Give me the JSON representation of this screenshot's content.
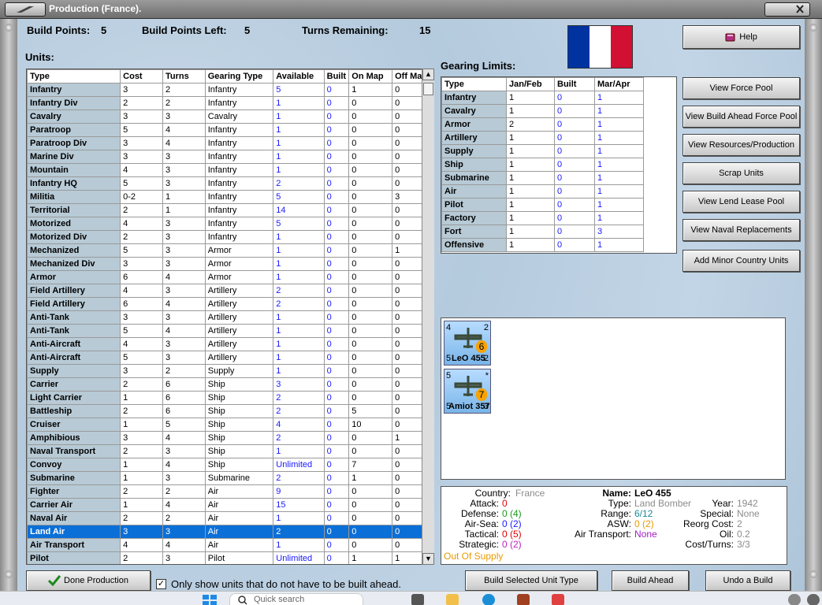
{
  "window": {
    "title": "Production (France)."
  },
  "summary": {
    "build_points_label": "Build Points:",
    "build_points": "5",
    "build_points_left_label": "Build Points Left:",
    "build_points_left": "5",
    "turns_remaining_label": "Turns Remaining:",
    "turns_remaining": "15"
  },
  "units": {
    "heading": "Units:",
    "columns": [
      "Type",
      "Cost",
      "Turns",
      "Gearing Type",
      "Available",
      "Built",
      "On Map",
      "Off Map"
    ],
    "rows": [
      [
        "Infantry",
        "3",
        "2",
        "Infantry",
        "5",
        "0",
        "1",
        "0"
      ],
      [
        "Infantry Div",
        "2",
        "2",
        "Infantry",
        "1",
        "0",
        "0",
        "0"
      ],
      [
        "Cavalry",
        "3",
        "3",
        "Cavalry",
        "1",
        "0",
        "0",
        "0"
      ],
      [
        "Paratroop",
        "5",
        "4",
        "Infantry",
        "1",
        "0",
        "0",
        "0"
      ],
      [
        "Paratroop Div",
        "3",
        "4",
        "Infantry",
        "1",
        "0",
        "0",
        "0"
      ],
      [
        "Marine Div",
        "3",
        "3",
        "Infantry",
        "1",
        "0",
        "0",
        "0"
      ],
      [
        "Mountain",
        "4",
        "3",
        "Infantry",
        "1",
        "0",
        "0",
        "0"
      ],
      [
        "Infantry HQ",
        "5",
        "3",
        "Infantry",
        "2",
        "0",
        "0",
        "0"
      ],
      [
        "Militia",
        "0-2",
        "1",
        "Infantry",
        "5",
        "0",
        "0",
        "3"
      ],
      [
        "Territorial",
        "2",
        "1",
        "Infantry",
        "14",
        "0",
        "0",
        "0"
      ],
      [
        "Motorized",
        "4",
        "3",
        "Infantry",
        "5",
        "0",
        "0",
        "0"
      ],
      [
        "Motorized Div",
        "2",
        "3",
        "Infantry",
        "1",
        "0",
        "0",
        "0"
      ],
      [
        "Mechanized",
        "5",
        "3",
        "Armor",
        "1",
        "0",
        "0",
        "1"
      ],
      [
        "Mechanized Div",
        "3",
        "3",
        "Armor",
        "1",
        "0",
        "0",
        "0"
      ],
      [
        "Armor",
        "6",
        "4",
        "Armor",
        "1",
        "0",
        "0",
        "0"
      ],
      [
        "Field Artillery",
        "4",
        "3",
        "Artillery",
        "2",
        "0",
        "0",
        "0"
      ],
      [
        "Field Artillery",
        "6",
        "4",
        "Artillery",
        "2",
        "0",
        "0",
        "0"
      ],
      [
        "Anti-Tank",
        "3",
        "3",
        "Artillery",
        "1",
        "0",
        "0",
        "0"
      ],
      [
        "Anti-Tank",
        "5",
        "4",
        "Artillery",
        "1",
        "0",
        "0",
        "0"
      ],
      [
        "Anti-Aircraft",
        "4",
        "3",
        "Artillery",
        "1",
        "0",
        "0",
        "0"
      ],
      [
        "Anti-Aircraft",
        "5",
        "3",
        "Artillery",
        "1",
        "0",
        "0",
        "0"
      ],
      [
        "Supply",
        "3",
        "2",
        "Supply",
        "1",
        "0",
        "0",
        "0"
      ],
      [
        "Carrier",
        "2",
        "6",
        "Ship",
        "3",
        "0",
        "0",
        "0"
      ],
      [
        "Light Carrier",
        "1",
        "6",
        "Ship",
        "2",
        "0",
        "0",
        "0"
      ],
      [
        "Battleship",
        "2",
        "6",
        "Ship",
        "2",
        "0",
        "5",
        "0"
      ],
      [
        "Cruiser",
        "1",
        "5",
        "Ship",
        "4",
        "0",
        "10",
        "0"
      ],
      [
        "Amphibious",
        "3",
        "4",
        "Ship",
        "2",
        "0",
        "0",
        "1"
      ],
      [
        "Naval Transport",
        "2",
        "3",
        "Ship",
        "1",
        "0",
        "0",
        "0"
      ],
      [
        "Convoy",
        "1",
        "4",
        "Ship",
        "Unlimited",
        "0",
        "7",
        "0"
      ],
      [
        "Submarine",
        "1",
        "3",
        "Submarine",
        "2",
        "0",
        "1",
        "0"
      ],
      [
        "Fighter",
        "2",
        "2",
        "Air",
        "9",
        "0",
        "0",
        "0"
      ],
      [
        "Carrier Air",
        "1",
        "4",
        "Air",
        "15",
        "0",
        "0",
        "0"
      ],
      [
        "Naval Air",
        "2",
        "2",
        "Air",
        "1",
        "0",
        "0",
        "0"
      ],
      [
        "Land Air",
        "3",
        "3",
        "Air",
        "2",
        "0",
        "0",
        "0"
      ],
      [
        "Air Transport",
        "4",
        "4",
        "Air",
        "1",
        "0",
        "0",
        "0"
      ],
      [
        "Pilot",
        "2",
        "3",
        "Pilot",
        "Unlimited",
        "0",
        "1",
        "1"
      ]
    ],
    "selected_row": 33
  },
  "gearing": {
    "heading": "Gearing Limits:",
    "columns": [
      "Type",
      "Jan/Feb",
      "Built",
      "Mar/Apr"
    ],
    "rows": [
      [
        "Infantry",
        "1",
        "0",
        "1"
      ],
      [
        "Cavalry",
        "1",
        "0",
        "1"
      ],
      [
        "Armor",
        "2",
        "0",
        "1"
      ],
      [
        "Artillery",
        "1",
        "0",
        "1"
      ],
      [
        "Supply",
        "1",
        "0",
        "1"
      ],
      [
        "Ship",
        "1",
        "0",
        "1"
      ],
      [
        "Submarine",
        "1",
        "0",
        "1"
      ],
      [
        "Air",
        "1",
        "0",
        "1"
      ],
      [
        "Pilot",
        "1",
        "0",
        "1"
      ],
      [
        "Factory",
        "1",
        "0",
        "1"
      ],
      [
        "Fort",
        "1",
        "0",
        "3"
      ],
      [
        "Offensive",
        "1",
        "0",
        "1"
      ]
    ]
  },
  "flag": {
    "colors": [
      "#0033a0",
      "#ffffff",
      "#d21034"
    ]
  },
  "buttons": {
    "help": "Help",
    "view_force_pool": "View Force Pool",
    "view_build_ahead": "View Build Ahead Force Pool",
    "view_resources": "View Resources/Production",
    "scrap_units": "Scrap Units",
    "view_lend_lease": "View Lend Lease Pool",
    "view_naval_replacements": "View Naval Replacements",
    "add_minor": "Add Minor Country Units",
    "done_production": "Done Production",
    "only_show": "Only show units that do not have to be built ahead.",
    "build_selected": "Build Selected Unit Type",
    "build_ahead": "Build Ahead",
    "undo_build": "Undo a Build"
  },
  "counters": [
    {
      "name": "LeO 455",
      "tl": "4",
      "tr": "2",
      "bl": "5",
      "br": "2",
      "badge": "6"
    },
    {
      "name": "Amiot 357",
      "tl": "5",
      "tr": "*",
      "bl": "5",
      "br": "3",
      "badge": "7"
    }
  ],
  "details": {
    "country_label": "Country:",
    "country": "France",
    "attack_label": "Attack:",
    "attack": "0",
    "defense_label": "Defense:",
    "defense": "0 (4)",
    "airsea_label": "Air-Sea:",
    "airsea": "0 (2)",
    "tactical_label": "Tactical:",
    "tactical": "0 (5)",
    "strategic_label": "Strategic:",
    "strategic": "0 (2)",
    "supply_status": "Out Of Supply",
    "name_label": "Name:",
    "name": "LeO 455",
    "type_label": "Type:",
    "type": "Land Bomber",
    "year_label": "Year:",
    "year": "1942",
    "range_label": "Range:",
    "range": "6/12",
    "special_label": "Special:",
    "special": "None",
    "asw_label": "ASW:",
    "asw": "0 (2)",
    "reorg_label": "Reorg Cost:",
    "reorg": "2",
    "airtransport_label": "Air Transport:",
    "airtransport": "None",
    "oil_label": "Oil:",
    "oil": "0.2",
    "costturns_label": "Cost/Turns:",
    "costturns": "3/3"
  },
  "taskbar": {
    "search_placeholder": "Quick search"
  }
}
